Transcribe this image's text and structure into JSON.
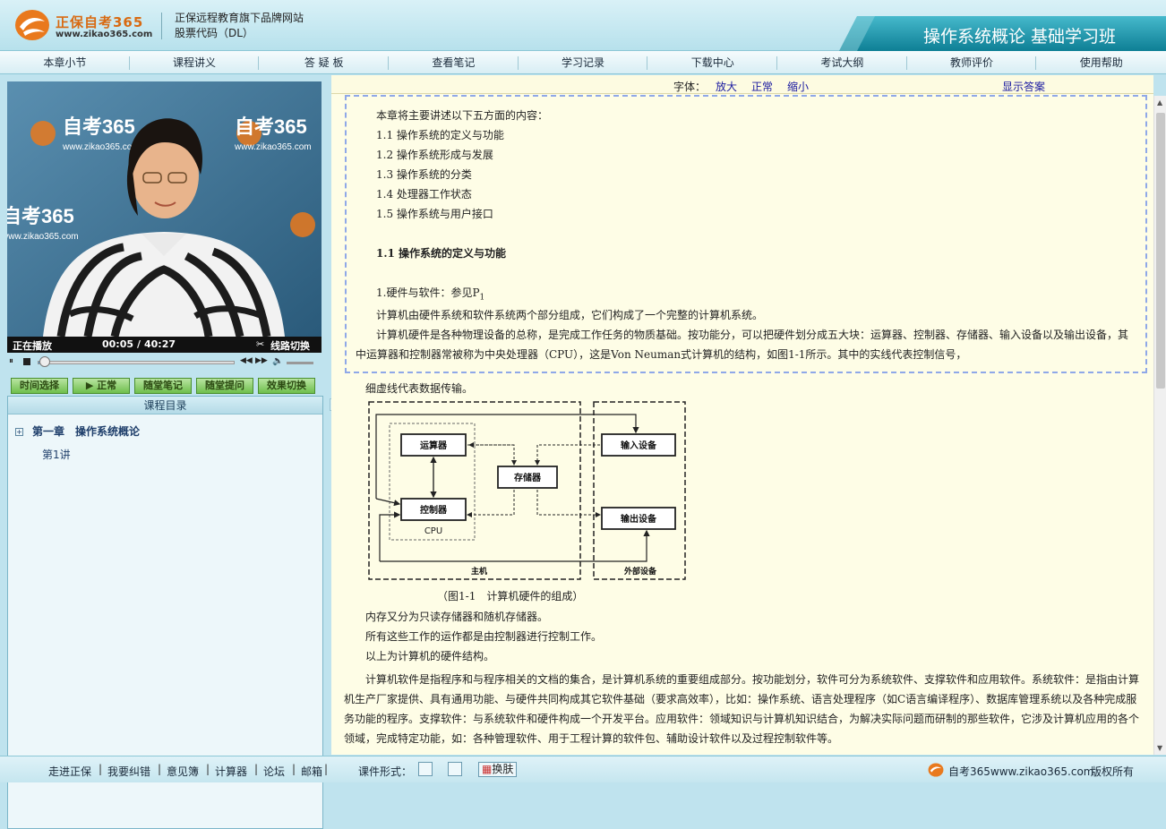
{
  "header": {
    "brand": "正保自考365",
    "url": "www.zikao365.com",
    "tagline_line1": "正保远程教育旗下品牌网站",
    "tagline_line2": "股票代码（DL）",
    "course_title": "操作系统概论 基础学习班"
  },
  "nav": [
    "本章小节",
    "课程讲义",
    "答 疑 板",
    "查看笔记",
    "学习记录",
    "下载中心",
    "考试大纲",
    "教师评价",
    "使用帮助"
  ],
  "video": {
    "watermark": "自考365",
    "watermark_url": "www.zikao365.com",
    "status": "正在播放",
    "time_current": "00:05",
    "time_sep": "/",
    "time_total": "40:27",
    "line_switch": "线路切换",
    "progress": 0.002
  },
  "video_buttons": [
    "时间选择",
    "正常",
    "随堂笔记",
    "随堂提问",
    "效果切换"
  ],
  "toc": {
    "heading": "课程目录",
    "chapter": "第一章　操作系统概论",
    "lecture": "第1讲"
  },
  "fontbar": {
    "label": "字体：",
    "bigger": "放大",
    "normal": "正常",
    "smaller": "缩小",
    "show_answer": "显示答案"
  },
  "content": {
    "intro": "本章将主要讲述以下五方面的内容：",
    "toc_items": [
      "1.1 操作系统的定义与功能",
      "1.2 操作系统形成与发展",
      "1.3 操作系统的分类",
      "1.4 处理器工作状态",
      "1.5 操作系统与用户接口"
    ],
    "section_title": "1.1 操作系统的定义与功能",
    "hw_sw": "1.硬件与软件：参见P",
    "hw_sw_sub": "1",
    "p1": "计算机由硬件系统和软件系统两个部分组成，它们构成了一个完整的计算机系统。",
    "p2a": "计算机硬件是各种物理设备的总称，是完成工作任务的物质基础。按功能分，可以把硬件划分成五大块：运算器、控制器、存储器、输入设备以及输出设备，其",
    "p2b": "中运算器和控制器常被称为中央处理器（CPU），这是Von Neuman式计算机的结构，如图1-1所示。其中的实线代表控制信号，",
    "p3": "细虚线代表数据传输。",
    "fig_caption": "（图1-1　计算机硬件的组成）",
    "p4": "内存又分为只读存储器和随机存储器。",
    "p5": "所有这些工作的运作都是由控制器进行控制工作。",
    "p6": "以上为计算机的硬件结构。",
    "p7a": "计算机软件是指程序和与程序相关的文档的集合，是计算机系统的重要组成部分。按功能划分，软件可分为系统软件、支撑软件和应用软件。系统软件：是指由计算",
    "p7b": "机生产厂家提供、具有通用功能、与硬件共同构成其它软件基础（要求高效率），比如：操作系统、语言处理程序（如C语言编译程序）、数据库管理系统以及各种完成服",
    "p7c": "务功能的程序。支撑软件：与系统软件和硬件构成一个开发平台。应用软件：领域知识与计算机知识结合，为解决实际问题而研制的那些软件，它涉及计算机应用的各个",
    "p7d": "领域，完成特定功能，如：各种管理软件、用于工程计算的软件包、辅助设计软件以及过程控制软件等。"
  },
  "figure": {
    "alu": "运算器",
    "memory": "存储器",
    "input": "输入设备",
    "control": "控制器",
    "output": "输出设备",
    "cpu": "CPU",
    "host": "主机",
    "peripheral": "外部设备"
  },
  "footer": {
    "links": [
      "走进正保",
      "我要纠错",
      "意见簿",
      "计算器",
      "论坛",
      "邮箱"
    ],
    "format_label": "课件形式：",
    "skin": "换肤",
    "site": "自考365www.zikao365.com",
    "copyright": "版权所有"
  },
  "colors": {
    "accent": "#1aa0b8",
    "link": "#1a1aa0",
    "brand_orange": "#d86a12"
  }
}
